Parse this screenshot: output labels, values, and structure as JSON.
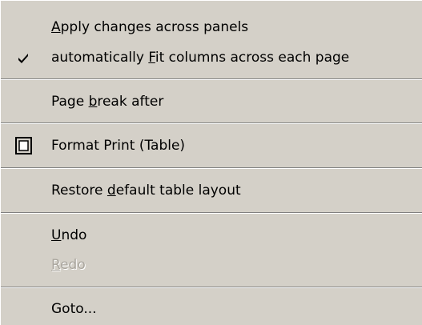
{
  "menu": {
    "items": {
      "apply_changes": {
        "label": "Apply changes across panels",
        "mnemonic": "A"
      },
      "auto_fit": {
        "label": "automatically Fit columns across each page",
        "mnemonic": "F",
        "checked": true
      },
      "page_break": {
        "label": "Page break after",
        "mnemonic": "b"
      },
      "format_print": {
        "label": "Format Print (Table)",
        "icon": "table-frame-icon"
      },
      "restore_layout": {
        "label": "Restore default table layout",
        "mnemonic": "d"
      },
      "undo": {
        "label": "Undo",
        "mnemonic": "U"
      },
      "redo": {
        "label": "Redo",
        "mnemonic": "R",
        "disabled": true
      },
      "goto": {
        "label": "Goto..."
      }
    }
  },
  "colors": {
    "menu_bg": "#d4d0c8",
    "separator_dark": "#808080",
    "separator_light": "#ffffff",
    "disabled_text": "#a9a59d"
  }
}
